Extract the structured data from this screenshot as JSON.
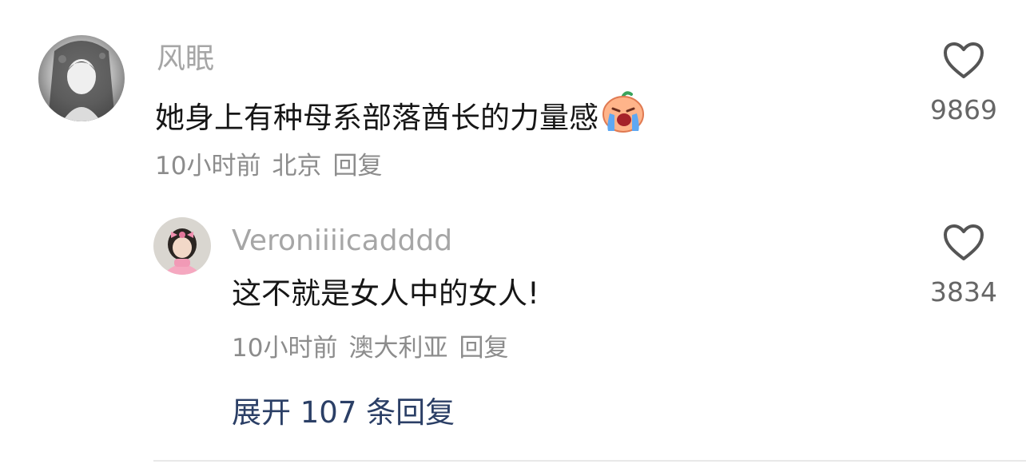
{
  "comments": [
    {
      "username": "风眠",
      "text": "她身上有种母系部落酋长的力量感",
      "emoji_icon": "crying-face-emoji",
      "time": "10小时前",
      "location": "北京",
      "reply_label": "回复",
      "likes": "9869",
      "avatar_icon": "anime-girl-avatar"
    },
    {
      "username": "Veroniiiicadddd",
      "text": "这不就是女人中的女人!",
      "time": "10小时前",
      "location": "澳大利亚",
      "reply_label": "回复",
      "likes": "3834",
      "avatar_icon": "girl-pink-bow-avatar"
    }
  ],
  "expand_replies": "展开 107 条回复",
  "watermark": "",
  "colors": {
    "username": "#a6a6a6",
    "text": "#161616",
    "meta": "#8c8c8c",
    "expand_link": "#2b3f66",
    "heart_stroke": "#555555"
  }
}
